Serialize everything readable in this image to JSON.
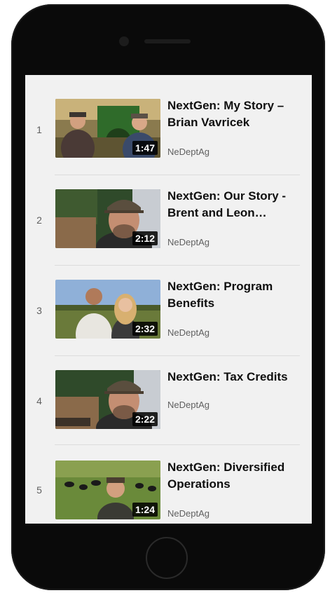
{
  "playlist": {
    "items": [
      {
        "index": "1",
        "title": "NextGen: My Story – Brian Vavricek",
        "channel": "NeDeptAg",
        "duration": "1:47",
        "thumb_icon": "farmers-tractor-thumbnail"
      },
      {
        "index": "2",
        "title": "NextGen: Our Story - Brent and Leon…",
        "channel": "NeDeptAg",
        "duration": "2:12",
        "thumb_icon": "farmer-cap-thumbnail"
      },
      {
        "index": "3",
        "title": "NextGen: Program Benefits",
        "channel": "NeDeptAg",
        "duration": "2:32",
        "thumb_icon": "couple-field-thumbnail"
      },
      {
        "index": "4",
        "title": "NextGen: Tax Credits",
        "channel": "NeDeptAg",
        "duration": "2:22",
        "thumb_icon": "farmer-barn-thumbnail"
      },
      {
        "index": "5",
        "title": "NextGen: Diversified Operations",
        "channel": "NeDeptAg",
        "duration": "1:24",
        "thumb_icon": "cattle-pasture-thumbnail"
      }
    ]
  },
  "colors": {
    "screen_background": "#f1f1f1",
    "phone_frame": "#0a0a0a",
    "title_text": "#0f0f0f",
    "meta_text": "#606060"
  }
}
